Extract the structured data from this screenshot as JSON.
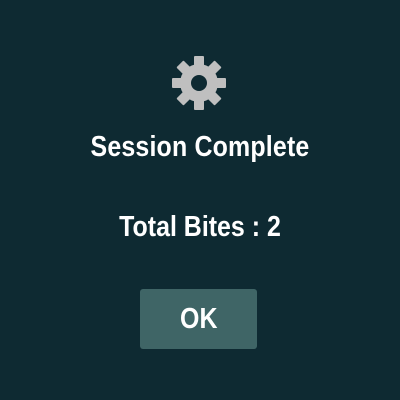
{
  "dialog": {
    "icon": "gear-icon",
    "title": "Session Complete",
    "total_label": "Total Bites : 2",
    "ok_label": "OK"
  },
  "colors": {
    "background": "#0e2a32",
    "gear": "#bfbfbf",
    "button": "#3f6566",
    "text": "#ffffff"
  }
}
